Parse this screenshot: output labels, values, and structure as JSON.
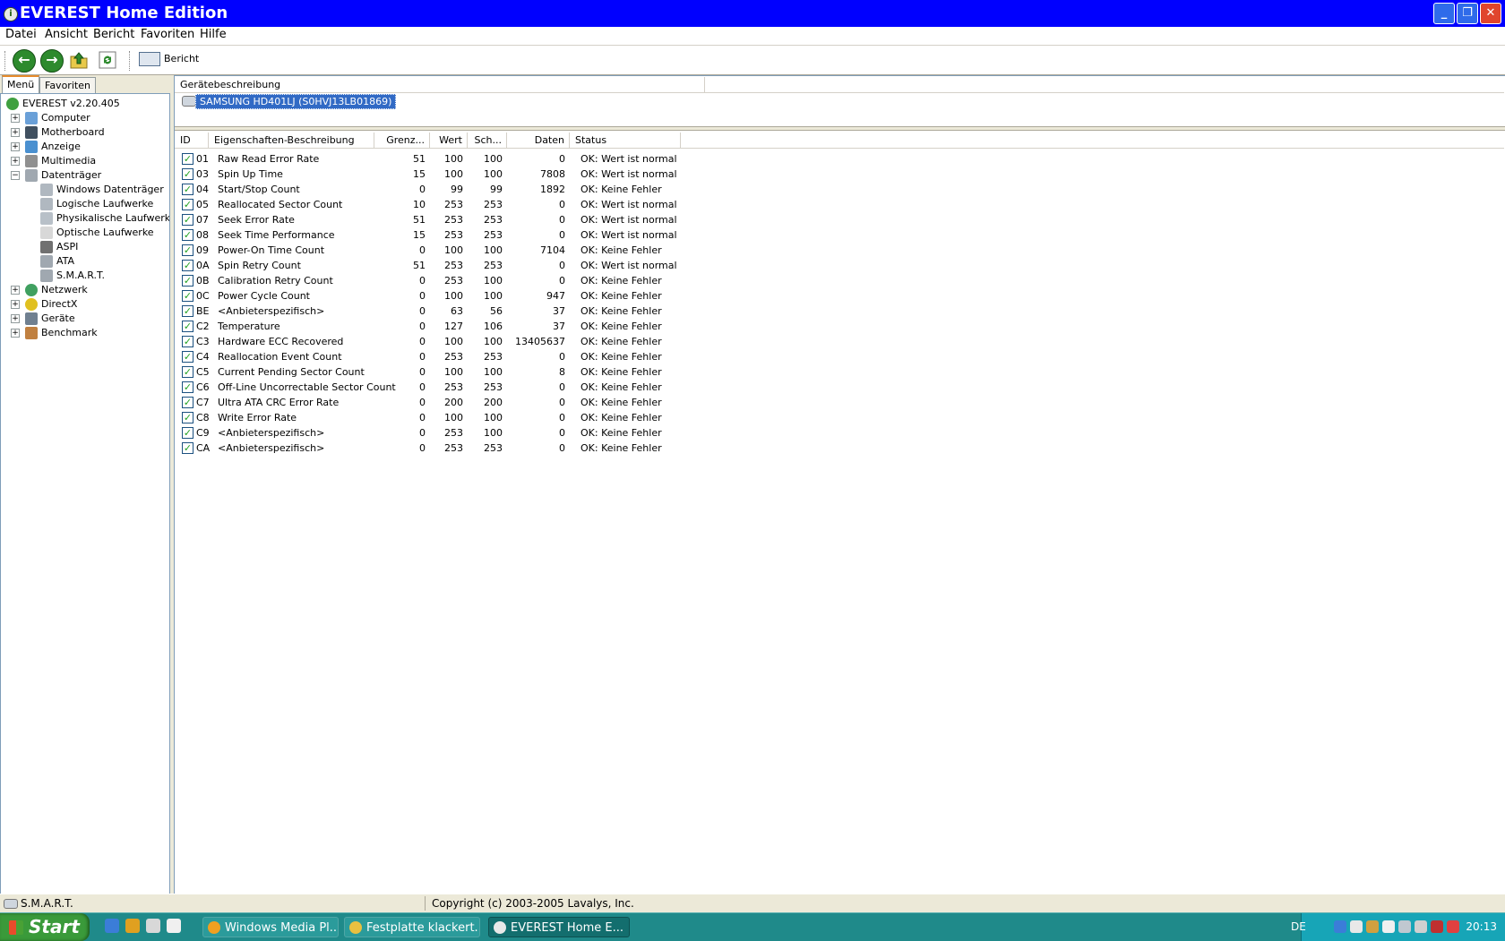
{
  "window": {
    "title": "EVEREST Home Edition",
    "controls": {
      "minimize": "_",
      "restore": "❐",
      "close": "✕"
    }
  },
  "menu": [
    "Datei",
    "Ansicht",
    "Bericht",
    "Favoriten",
    "Hilfe"
  ],
  "toolbar": {
    "report_label": "Bericht"
  },
  "left_tabs": [
    "Menü",
    "Favoriten"
  ],
  "tree": [
    {
      "label": "EVEREST v2.20.405",
      "level": 0,
      "expander": "",
      "icon": "info-icon"
    },
    {
      "label": "Computer",
      "level": 1,
      "expander": "+",
      "icon": "computer-icon"
    },
    {
      "label": "Motherboard",
      "level": 1,
      "expander": "+",
      "icon": "motherboard-icon"
    },
    {
      "label": "Anzeige",
      "level": 1,
      "expander": "+",
      "icon": "display-icon"
    },
    {
      "label": "Multimedia",
      "level": 1,
      "expander": "+",
      "icon": "multimedia-icon"
    },
    {
      "label": "Datenträger",
      "level": 1,
      "expander": "−",
      "icon": "storage-icon"
    },
    {
      "label": "Windows Datenträger",
      "level": 2,
      "expander": "",
      "icon": "disk-icon"
    },
    {
      "label": "Logische Laufwerke",
      "level": 2,
      "expander": "",
      "icon": "logical-drive-icon"
    },
    {
      "label": "Physikalische Laufwerke",
      "level": 2,
      "expander": "",
      "icon": "physical-drive-icon"
    },
    {
      "label": "Optische Laufwerke",
      "level": 2,
      "expander": "",
      "icon": "optical-drive-icon"
    },
    {
      "label": "ASPI",
      "level": 2,
      "expander": "",
      "icon": "aspi-icon"
    },
    {
      "label": "ATA",
      "level": 2,
      "expander": "",
      "icon": "ata-icon"
    },
    {
      "label": "S.M.A.R.T.",
      "level": 2,
      "expander": "",
      "icon": "smart-icon"
    },
    {
      "label": "Netzwerk",
      "level": 1,
      "expander": "+",
      "icon": "network-icon"
    },
    {
      "label": "DirectX",
      "level": 1,
      "expander": "+",
      "icon": "directx-icon"
    },
    {
      "label": "Geräte",
      "level": 1,
      "expander": "+",
      "icon": "devices-icon"
    },
    {
      "label": "Benchmark",
      "level": 1,
      "expander": "+",
      "icon": "hourglass-icon"
    }
  ],
  "device": {
    "header": "Gerätebeschreibung",
    "selected": "SAMSUNG HD401LJ (S0HVJ13LB01869)"
  },
  "smart": {
    "columns": [
      "ID",
      "Eigenschaften-Beschreibung",
      "Grenz...",
      "Wert",
      "Sch...",
      "Daten",
      "Status"
    ],
    "rows": [
      {
        "id": "01",
        "desc": "Raw Read Error Rate",
        "grenz": "51",
        "wert": "100",
        "sch": "100",
        "daten": "0",
        "status": "OK: Wert ist normal"
      },
      {
        "id": "03",
        "desc": "Spin Up Time",
        "grenz": "15",
        "wert": "100",
        "sch": "100",
        "daten": "7808",
        "status": "OK: Wert ist normal"
      },
      {
        "id": "04",
        "desc": "Start/Stop Count",
        "grenz": "0",
        "wert": "99",
        "sch": "99",
        "daten": "1892",
        "status": "OK: Keine Fehler"
      },
      {
        "id": "05",
        "desc": "Reallocated Sector Count",
        "grenz": "10",
        "wert": "253",
        "sch": "253",
        "daten": "0",
        "status": "OK: Wert ist normal"
      },
      {
        "id": "07",
        "desc": "Seek Error Rate",
        "grenz": "51",
        "wert": "253",
        "sch": "253",
        "daten": "0",
        "status": "OK: Wert ist normal"
      },
      {
        "id": "08",
        "desc": "Seek Time Performance",
        "grenz": "15",
        "wert": "253",
        "sch": "253",
        "daten": "0",
        "status": "OK: Wert ist normal"
      },
      {
        "id": "09",
        "desc": "Power-On Time Count",
        "grenz": "0",
        "wert": "100",
        "sch": "100",
        "daten": "7104",
        "status": "OK: Keine Fehler"
      },
      {
        "id": "0A",
        "desc": "Spin Retry Count",
        "grenz": "51",
        "wert": "253",
        "sch": "253",
        "daten": "0",
        "status": "OK: Wert ist normal"
      },
      {
        "id": "0B",
        "desc": "Calibration Retry Count",
        "grenz": "0",
        "wert": "253",
        "sch": "100",
        "daten": "0",
        "status": "OK: Keine Fehler"
      },
      {
        "id": "0C",
        "desc": "Power Cycle Count",
        "grenz": "0",
        "wert": "100",
        "sch": "100",
        "daten": "947",
        "status": "OK: Keine Fehler"
      },
      {
        "id": "BE",
        "desc": "<Anbieterspezifisch>",
        "grenz": "0",
        "wert": "63",
        "sch": "56",
        "daten": "37",
        "status": "OK: Keine Fehler"
      },
      {
        "id": "C2",
        "desc": "Temperature",
        "grenz": "0",
        "wert": "127",
        "sch": "106",
        "daten": "37",
        "status": "OK: Keine Fehler"
      },
      {
        "id": "C3",
        "desc": "Hardware ECC Recovered",
        "grenz": "0",
        "wert": "100",
        "sch": "100",
        "daten": "13405637",
        "status": "OK: Keine Fehler"
      },
      {
        "id": "C4",
        "desc": "Reallocation Event Count",
        "grenz": "0",
        "wert": "253",
        "sch": "253",
        "daten": "0",
        "status": "OK: Keine Fehler"
      },
      {
        "id": "C5",
        "desc": "Current Pending Sector Count",
        "grenz": "0",
        "wert": "100",
        "sch": "100",
        "daten": "8",
        "status": "OK: Keine Fehler"
      },
      {
        "id": "C6",
        "desc": "Off-Line Uncorrectable Sector Count",
        "grenz": "0",
        "wert": "253",
        "sch": "253",
        "daten": "0",
        "status": "OK: Keine Fehler"
      },
      {
        "id": "C7",
        "desc": "Ultra ATA CRC Error Rate",
        "grenz": "0",
        "wert": "200",
        "sch": "200",
        "daten": "0",
        "status": "OK: Keine Fehler"
      },
      {
        "id": "C8",
        "desc": "Write Error Rate",
        "grenz": "0",
        "wert": "100",
        "sch": "100",
        "daten": "0",
        "status": "OK: Keine Fehler"
      },
      {
        "id": "C9",
        "desc": "<Anbieterspezifisch>",
        "grenz": "0",
        "wert": "253",
        "sch": "100",
        "daten": "0",
        "status": "OK: Keine Fehler"
      },
      {
        "id": "CA",
        "desc": "<Anbieterspezifisch>",
        "grenz": "0",
        "wert": "253",
        "sch": "253",
        "daten": "0",
        "status": "OK: Keine Fehler"
      }
    ]
  },
  "statusbar": {
    "left": "S.M.A.R.T.",
    "right": "Copyright (c) 2003-2005 Lavalys, Inc."
  },
  "taskbar": {
    "start_label": "Start",
    "tasks": [
      {
        "label": "Windows Media Pl...",
        "active": false
      },
      {
        "label": "Festplatte klackert...",
        "active": false
      },
      {
        "label": "EVEREST Home E...",
        "active": true
      }
    ],
    "lang": "DE",
    "clock": "20:13"
  },
  "colors": {
    "titlebar": "#0000ff",
    "selection": "#316ac5",
    "taskbar": "#1f8a8a",
    "check": "#21a121"
  }
}
